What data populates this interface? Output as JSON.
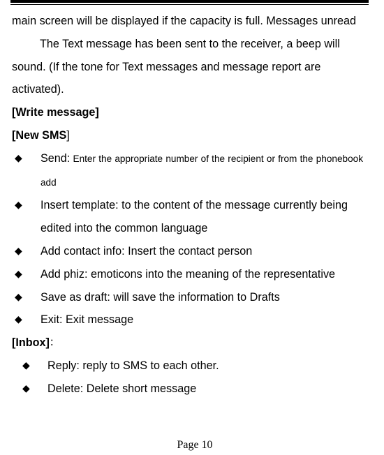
{
  "document": {
    "page_label": "Page 10",
    "bullet_glyph": "◆",
    "text_color": "#000000",
    "background_color": "#ffffff"
  },
  "paragraphs": [
    {
      "id": "p1",
      "text": "main screen will be displayed if the capacity is full. Messages unread"
    },
    {
      "id": "p2",
      "text": "The Text message has been sent to the receiver, a beep will sound. (If the tone for Text messages and message report are activated)."
    }
  ],
  "headings": {
    "write_message": "[Write message]",
    "new_sms_open": "[New SMS",
    "new_sms_close": "]",
    "inbox": "[Inbox]",
    "inbox_colon": "："
  },
  "write_message_items": [
    {
      "label": "Send:",
      "description": " Enter the appropriate number of the recipient or from the phonebook add",
      "small_description": true,
      "justified": true
    },
    {
      "label": "Insert template:",
      "description": " to the content of the message currently being edited into the common language",
      "small_description": false,
      "justified": false
    },
    {
      "label": "Add contact info:",
      "description": " Insert the contact person",
      "small_description": false,
      "justified": false
    },
    {
      "label": "Add phiz:",
      "description": " emoticons into the meaning of the representative",
      "small_description": false,
      "justified": true
    },
    {
      "label": "Save as draft:",
      "description": " will save the information to Drafts",
      "small_description": false,
      "justified": false
    },
    {
      "label": "Exit:",
      "description": " Exit message",
      "small_description": false,
      "justified": false
    }
  ],
  "inbox_items": [
    {
      "label": "Reply:",
      "description": " reply to SMS to each other."
    },
    {
      "label": "Delete:",
      "description": " Delete short message"
    }
  ]
}
